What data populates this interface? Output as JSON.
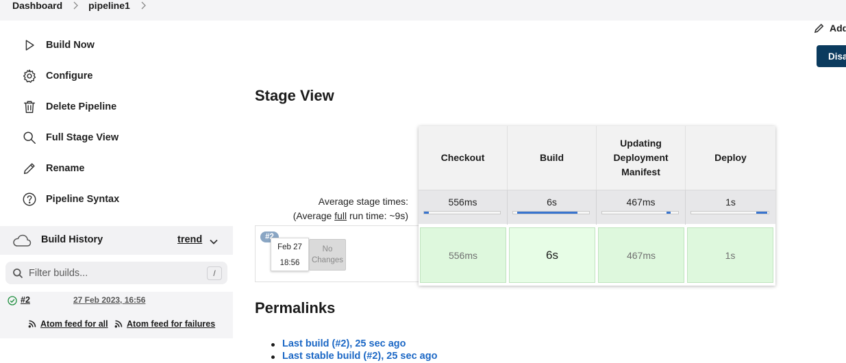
{
  "breadcrumb": {
    "items": [
      "Dashboard",
      "pipeline1"
    ]
  },
  "sidebar": {
    "tasks": [
      {
        "label": "Build Now",
        "icon": "play-icon"
      },
      {
        "label": "Configure",
        "icon": "gear-icon"
      },
      {
        "label": "Delete Pipeline",
        "icon": "trash-icon"
      },
      {
        "label": "Full Stage View",
        "icon": "search-icon"
      },
      {
        "label": "Rename",
        "icon": "pencil-icon"
      },
      {
        "label": "Pipeline Syntax",
        "icon": "help-icon"
      }
    ],
    "build_history": {
      "title": "Build History",
      "trend_label": "trend",
      "filter_placeholder": "Filter builds...",
      "filter_shortcut": "/",
      "builds": [
        {
          "number": "#2",
          "date": "27 Feb 2023, 16:56",
          "status": "success"
        }
      ],
      "atom_all": "Atom feed for all",
      "atom_failures": "Atom feed for failures"
    }
  },
  "header_actions": {
    "add_label": "Add",
    "disable_label": "Disa"
  },
  "stage_view": {
    "title": "Stage View",
    "avg_label": "Average stage times:",
    "avg_run_prefix": "(Average ",
    "avg_run_link": "full",
    "avg_run_suffix": " run time: ~9s)",
    "stages": [
      {
        "name": "Checkout",
        "avg": "556ms",
        "bar": 0.06,
        "cell": "556ms"
      },
      {
        "name": "Build",
        "avg": "6s",
        "bar": 0.8,
        "cell": "6s"
      },
      {
        "name": "Updating Deployment Manifest",
        "avg": "467ms",
        "bar": 0.05,
        "cell": "467ms"
      },
      {
        "name": "Deploy",
        "avg": "1s",
        "bar": 0.14,
        "cell": "1s"
      }
    ],
    "build": {
      "badge": "#2",
      "date": "Feb 27",
      "time": "18:56",
      "changes": "No Changes"
    }
  },
  "permalinks": {
    "title": "Permalinks",
    "items": [
      "Last build (#2), 25 sec ago",
      "Last stable build (#2), 25 sec ago"
    ]
  },
  "colors": {
    "accent": "#1b67c5",
    "disable_button": "#0b3b5e",
    "stage_success": "#def8dd",
    "progress": "#3874cf"
  }
}
